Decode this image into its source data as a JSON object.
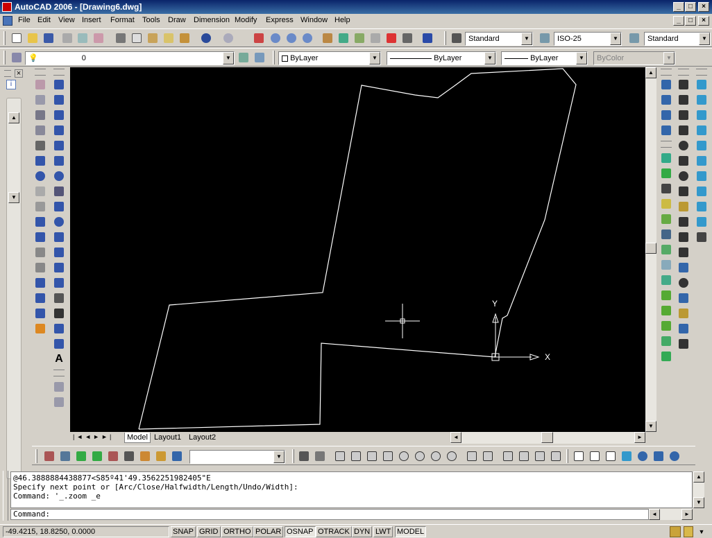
{
  "window": {
    "title": "AutoCAD 2006 - [Drawing6.dwg]",
    "controls": [
      "_",
      "□",
      "×"
    ]
  },
  "menu": {
    "items": [
      "File",
      "Edit",
      "View",
      "Insert",
      "Format",
      "Tools",
      "Draw",
      "Dimension",
      "Modify",
      "Express",
      "Window",
      "Help"
    ]
  },
  "styles_toolbar": {
    "text_style": "Standard",
    "dim_style": "ISO-25",
    "table_style": "Standard"
  },
  "layers_toolbar": {
    "layer": "0",
    "color": "ByLayer",
    "linetype": "ByLayer",
    "lineweight": "ByLayer",
    "plot_style": "ByColor"
  },
  "viewport": {
    "background": "#000000",
    "ucs_x_label": "X",
    "ucs_y_label": "Y"
  },
  "layout_tabs": [
    "Model",
    "Layout1",
    "Layout2"
  ],
  "command_window": {
    "history": [
      "@46.3888884438877<S85º41'49.3562251982405\"E",
      "Specify next point or [Arc/Close/Halfwidth/Length/Undo/Width]:",
      "Command: '_.zoom _e"
    ],
    "prompt": "Command:"
  },
  "status": {
    "coordinates": "-49.4215, 18.8250, 0.0000",
    "toggles": [
      {
        "label": "SNAP",
        "on": false
      },
      {
        "label": "GRID",
        "on": false
      },
      {
        "label": "ORTHO",
        "on": false
      },
      {
        "label": "POLAR",
        "on": false
      },
      {
        "label": "OSNAP",
        "on": true
      },
      {
        "label": "OTRACK",
        "on": false
      },
      {
        "label": "DYN",
        "on": false
      },
      {
        "label": "LWT",
        "on": false
      },
      {
        "label": "MODEL",
        "on": true
      }
    ]
  },
  "colors": {
    "title_bar": "#0a246a",
    "chrome": "#d4d0c8",
    "drawing_lines": "#ffffff"
  }
}
